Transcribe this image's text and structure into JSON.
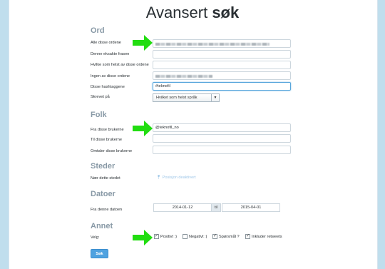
{
  "title": {
    "plain": "Avansert ",
    "bold": "søk"
  },
  "sections": {
    "words": "Ord",
    "people": "Folk",
    "places": "Steder",
    "dates": "Datoer",
    "other": "Annet"
  },
  "words": {
    "all_label": "Alle disse ordene",
    "exact_label": "Denne eksakte frasen",
    "any_label": "Hvilke som helst av disse ordene",
    "none_label": "Ingen av disse ordene",
    "hashtags_label": "Disse hashtaggene",
    "hashtags_value": "#teknofil",
    "lang_label": "Skrevet på",
    "lang_value": "Hvilket som helst språk"
  },
  "people": {
    "from_label": "Fra disse brukerne",
    "from_value": "@teknofil_no",
    "to_label": "Til disse brukerne",
    "mention_label": "Omtaler disse brukerne"
  },
  "places": {
    "near_label": "Nær dette stedet",
    "location_text": "Posisjon deaktivert"
  },
  "dates": {
    "from_label": "Fra denne datoen",
    "start": "2014-01-12",
    "til": "til",
    "end": "2015-04-01"
  },
  "other": {
    "select_label": "Velg:",
    "positive": "Positivt :)",
    "negative": "Negativt :(",
    "question": "Spørsmål ?",
    "retweets": "Inkluder retweets"
  },
  "submit": "Søk",
  "colors": {
    "accent": "#4fa2e0",
    "arrow": "#22dd11",
    "background": "#c0deed"
  }
}
